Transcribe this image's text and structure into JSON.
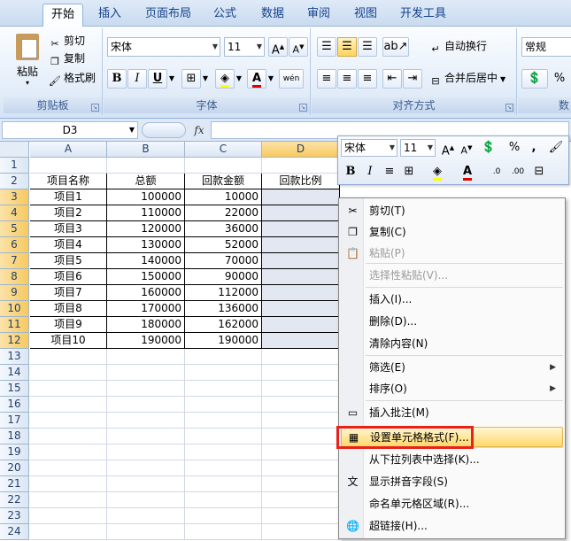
{
  "ribbon": {
    "tabs": [
      "开始",
      "插入",
      "页面布局",
      "公式",
      "数据",
      "审阅",
      "视图",
      "开发工具"
    ],
    "active_tab": "开始",
    "clipboard": {
      "paste": "粘贴",
      "cut": "剪切",
      "copy": "复制",
      "format_painter": "格式刷",
      "label": "剪贴板"
    },
    "font": {
      "name": "宋体",
      "size": "11",
      "label": "字体"
    },
    "alignment": {
      "wrap": "自动换行",
      "merge": "合并后居中",
      "label": "对齐方式"
    },
    "number": {
      "format": "常规",
      "label": "数"
    }
  },
  "formula_bar": {
    "name_box": "D3",
    "fx": "fx",
    "value": ""
  },
  "columns": [
    "A",
    "B",
    "C",
    "D"
  ],
  "rows": [
    "1",
    "2",
    "3",
    "4",
    "5",
    "6",
    "7",
    "8",
    "9",
    "10",
    "11",
    "12",
    "13",
    "14",
    "15",
    "16",
    "17",
    "18",
    "19",
    "20",
    "21",
    "22",
    "23",
    "24"
  ],
  "sheet": {
    "headers": [
      "项目名称",
      "总额",
      "回款金额",
      "回款比例"
    ],
    "data": [
      [
        "项目1",
        "100000",
        "10000"
      ],
      [
        "项目2",
        "110000",
        "22000"
      ],
      [
        "项目3",
        "120000",
        "36000"
      ],
      [
        "项目4",
        "130000",
        "52000"
      ],
      [
        "项目5",
        "140000",
        "70000"
      ],
      [
        "项目6",
        "150000",
        "90000"
      ],
      [
        "项目7",
        "160000",
        "112000"
      ],
      [
        "项目8",
        "170000",
        "136000"
      ],
      [
        "项目9",
        "180000",
        "162000"
      ],
      [
        "项目10",
        "190000",
        "190000"
      ]
    ]
  },
  "mini_toolbar": {
    "font": "宋体",
    "size": "11",
    "percent": "%",
    "comma": ",",
    "wen": "wén"
  },
  "context_menu": {
    "items": [
      {
        "label": "剪切(T)",
        "icon": "scissors-icon",
        "glyph": "✂"
      },
      {
        "label": "复制(C)",
        "icon": "copy-icon",
        "glyph": "❐"
      },
      {
        "label": "粘贴(P)",
        "icon": "paste-icon",
        "glyph": "📋",
        "disabled": true
      },
      {
        "label": "选择性粘贴(V)...",
        "disabled": true
      },
      {
        "label": "插入(I)..."
      },
      {
        "label": "删除(D)..."
      },
      {
        "label": "清除内容(N)"
      },
      {
        "label": "筛选(E)",
        "submenu": true
      },
      {
        "label": "排序(O)",
        "submenu": true
      },
      {
        "label": "插入批注(M)",
        "icon": "comment-icon",
        "glyph": "▭"
      },
      {
        "label": "设置单元格格式(F)...",
        "icon": "format-cells-icon",
        "glyph": "▦",
        "highlighted": true
      },
      {
        "label": "从下拉列表中选择(K)..."
      },
      {
        "label": "显示拼音字段(S)",
        "icon": "phonetic-icon",
        "glyph": "文"
      },
      {
        "label": "命名单元格区域(R)..."
      },
      {
        "label": "超链接(H)...",
        "icon": "hyperlink-icon",
        "glyph": "🌐"
      }
    ]
  }
}
